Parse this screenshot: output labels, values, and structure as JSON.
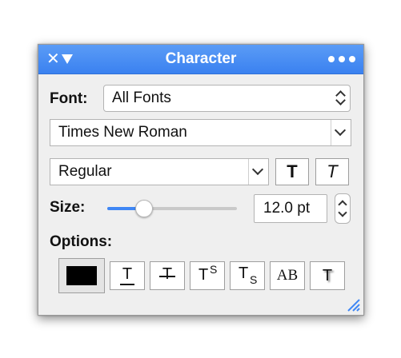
{
  "window": {
    "title": "Character"
  },
  "font": {
    "label": "Font:",
    "collection": "All Fonts",
    "family": "Times New Roman",
    "typeface": "Regular",
    "bold_glyph": "T",
    "italic_glyph": "T"
  },
  "size": {
    "label": "Size:",
    "value": "12.0 pt",
    "slider_fraction": 0.25
  },
  "options": {
    "label": "Options:",
    "color": "#000000",
    "buttons": [
      {
        "name": "underline",
        "glyph": "T"
      },
      {
        "name": "strikethrough",
        "glyph": "T"
      },
      {
        "name": "superscript",
        "glyph": "T",
        "sub": "S"
      },
      {
        "name": "subscript",
        "glyph": "T",
        "sub": "S"
      },
      {
        "name": "small-caps",
        "glyph": "AB"
      },
      {
        "name": "shadow",
        "glyph": "T"
      }
    ]
  },
  "colors": {
    "accent": "#3f87f5",
    "titlebar": "#4a8ff5"
  }
}
